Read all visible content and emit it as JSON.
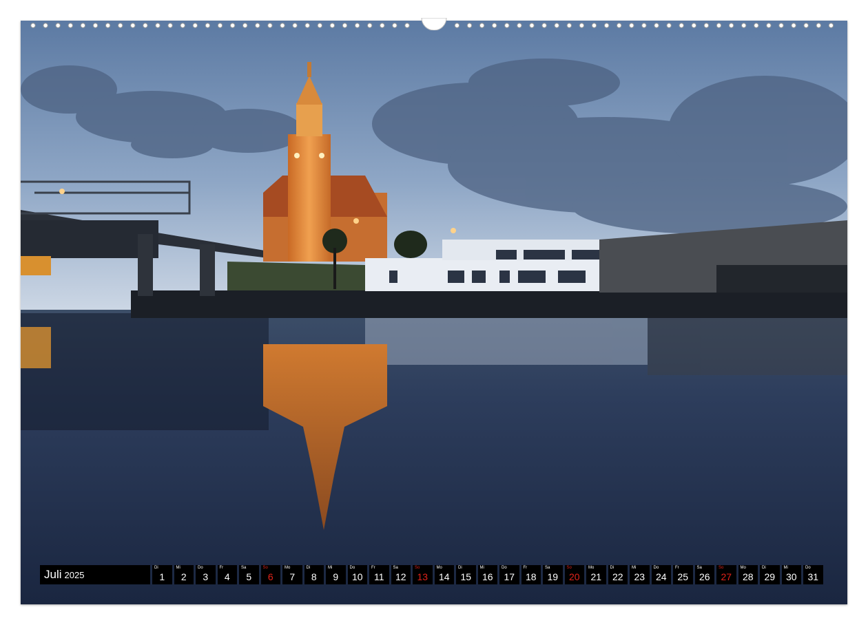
{
  "page": {
    "background": "#ffffff"
  },
  "calendar": {
    "month": "Juli",
    "year": "2025",
    "sunday_color": "#e2231a",
    "strip_color": "#000000",
    "days": [
      {
        "wd": "Di",
        "d": "1",
        "sun": false
      },
      {
        "wd": "Mi",
        "d": "2",
        "sun": false
      },
      {
        "wd": "Do",
        "d": "3",
        "sun": false
      },
      {
        "wd": "Fr",
        "d": "4",
        "sun": false
      },
      {
        "wd": "Sa",
        "d": "5",
        "sun": false
      },
      {
        "wd": "So",
        "d": "6",
        "sun": true
      },
      {
        "wd": "Mo",
        "d": "7",
        "sun": false
      },
      {
        "wd": "Di",
        "d": "8",
        "sun": false
      },
      {
        "wd": "Mi",
        "d": "9",
        "sun": false
      },
      {
        "wd": "Do",
        "d": "10",
        "sun": false
      },
      {
        "wd": "Fr",
        "d": "11",
        "sun": false
      },
      {
        "wd": "Sa",
        "d": "12",
        "sun": false
      },
      {
        "wd": "So",
        "d": "13",
        "sun": true
      },
      {
        "wd": "Mo",
        "d": "14",
        "sun": false
      },
      {
        "wd": "Di",
        "d": "15",
        "sun": false
      },
      {
        "wd": "Mi",
        "d": "16",
        "sun": false
      },
      {
        "wd": "Do",
        "d": "17",
        "sun": false
      },
      {
        "wd": "Fr",
        "d": "18",
        "sun": false
      },
      {
        "wd": "Sa",
        "d": "19",
        "sun": false
      },
      {
        "wd": "So",
        "d": "20",
        "sun": true
      },
      {
        "wd": "Mo",
        "d": "21",
        "sun": false
      },
      {
        "wd": "Di",
        "d": "22",
        "sun": false
      },
      {
        "wd": "Mi",
        "d": "23",
        "sun": false
      },
      {
        "wd": "Do",
        "d": "24",
        "sun": false
      },
      {
        "wd": "Fr",
        "d": "25",
        "sun": false
      },
      {
        "wd": "Sa",
        "d": "26",
        "sun": false
      },
      {
        "wd": "So",
        "d": "27",
        "sun": true
      },
      {
        "wd": "Mo",
        "d": "28",
        "sun": false
      },
      {
        "wd": "Di",
        "d": "29",
        "sun": false
      },
      {
        "wd": "Mi",
        "d": "30",
        "sun": false
      },
      {
        "wd": "Do",
        "d": "31",
        "sun": false
      }
    ]
  },
  "photo": {
    "subject": "harbor-office-tower-at-dusk",
    "colors": {
      "sky_top": "#5f7ea6",
      "sky_horizon": "#c9d6e6",
      "water": "#1e2c48",
      "tower_glow": "#e08a35"
    }
  }
}
